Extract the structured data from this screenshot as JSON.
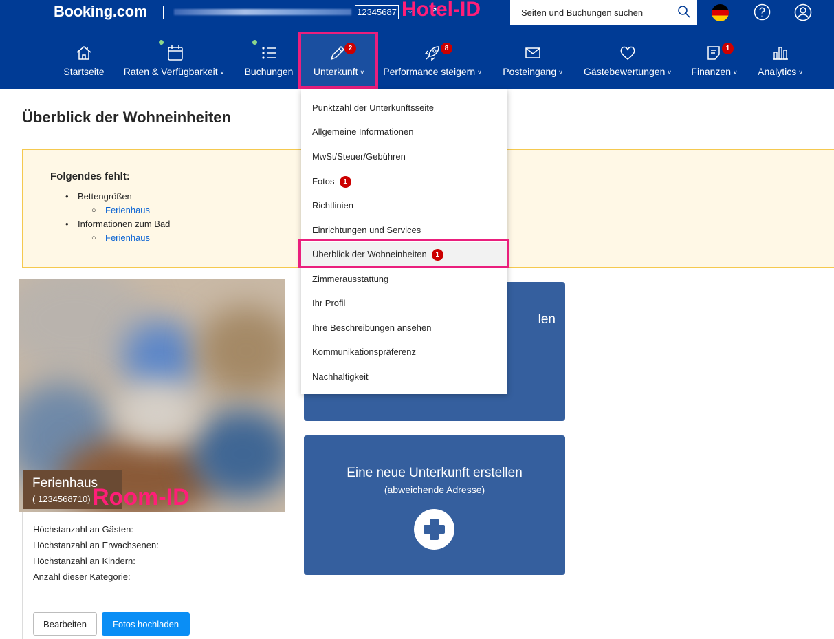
{
  "header": {
    "logo": "Booking.com",
    "hotel_id": "12345687",
    "search_placeholder": "Seiten und Buchungen suchen"
  },
  "annotations": {
    "hotel_id_label": "Hotel-ID",
    "room_id_label": "Room-ID"
  },
  "nav": {
    "items": [
      {
        "label": "Startseite",
        "icon": "home-icon"
      },
      {
        "label": "Raten & Verfügbarkeit",
        "icon": "calendar-icon"
      },
      {
        "label": "Buchungen",
        "icon": "list-icon"
      },
      {
        "label": "Unterkunft",
        "icon": "pencil-icon",
        "badge": "2"
      },
      {
        "label": "Performance steigern",
        "icon": "rocket-icon",
        "badge": "8"
      },
      {
        "label": "Posteingang",
        "icon": "envelope-icon"
      },
      {
        "label": "Gästebewertungen",
        "icon": "heart-icon"
      },
      {
        "label": "Finanzen",
        "icon": "invoice-icon",
        "badge": "1"
      },
      {
        "label": "Analytics",
        "icon": "bar-chart-icon"
      }
    ]
  },
  "dropdown": {
    "items": [
      {
        "label": "Punktzahl der Unterkunftsseite"
      },
      {
        "label": "Allgemeine Informationen"
      },
      {
        "label": "MwSt/Steuer/Gebühren"
      },
      {
        "label": "Fotos",
        "badge": "1"
      },
      {
        "label": "Richtlinien"
      },
      {
        "label": "Einrichtungen und Services"
      },
      {
        "label": "Überblick der Wohneinheiten",
        "badge": "1"
      },
      {
        "label": "Zimmerausstattung"
      },
      {
        "label": "Ihr Profil"
      },
      {
        "label": "Ihre Beschreibungen ansehen"
      },
      {
        "label": "Kommunikationspräferenz"
      },
      {
        "label": "Nachhaltigkeit"
      }
    ]
  },
  "page": {
    "title": "Überblick der Wohneinheiten"
  },
  "warning": {
    "title": "Folgendes fehlt:",
    "items": [
      {
        "label": "Bettengrößen",
        "sub": "Ferienhaus"
      },
      {
        "label": "Informationen zum Bad",
        "sub": "Ferienhaus"
      }
    ]
  },
  "room": {
    "name": "Ferienhaus",
    "id": "( 1234568710)",
    "specs": [
      "Höchstanzahl an Gästen:",
      "Höchstanzahl an Erwachsenen:",
      "Höchstanzahl an Kindern:",
      "Anzahl dieser Kategorie:"
    ],
    "edit_label": "Bearbeiten",
    "upload_label": "Fotos hochladen"
  },
  "tiles": {
    "tile1_partial_text": "len",
    "tile2_title": "Eine neue Unterkunft erstellen",
    "tile2_subtitle": "(abweichende Adresse)"
  },
  "colors": {
    "header_bg": "#003b95",
    "annotation": "#ea1f7d",
    "tile_bg": "#355f9e",
    "badge": "#cc0000",
    "primary_button": "#0a8ef5"
  }
}
